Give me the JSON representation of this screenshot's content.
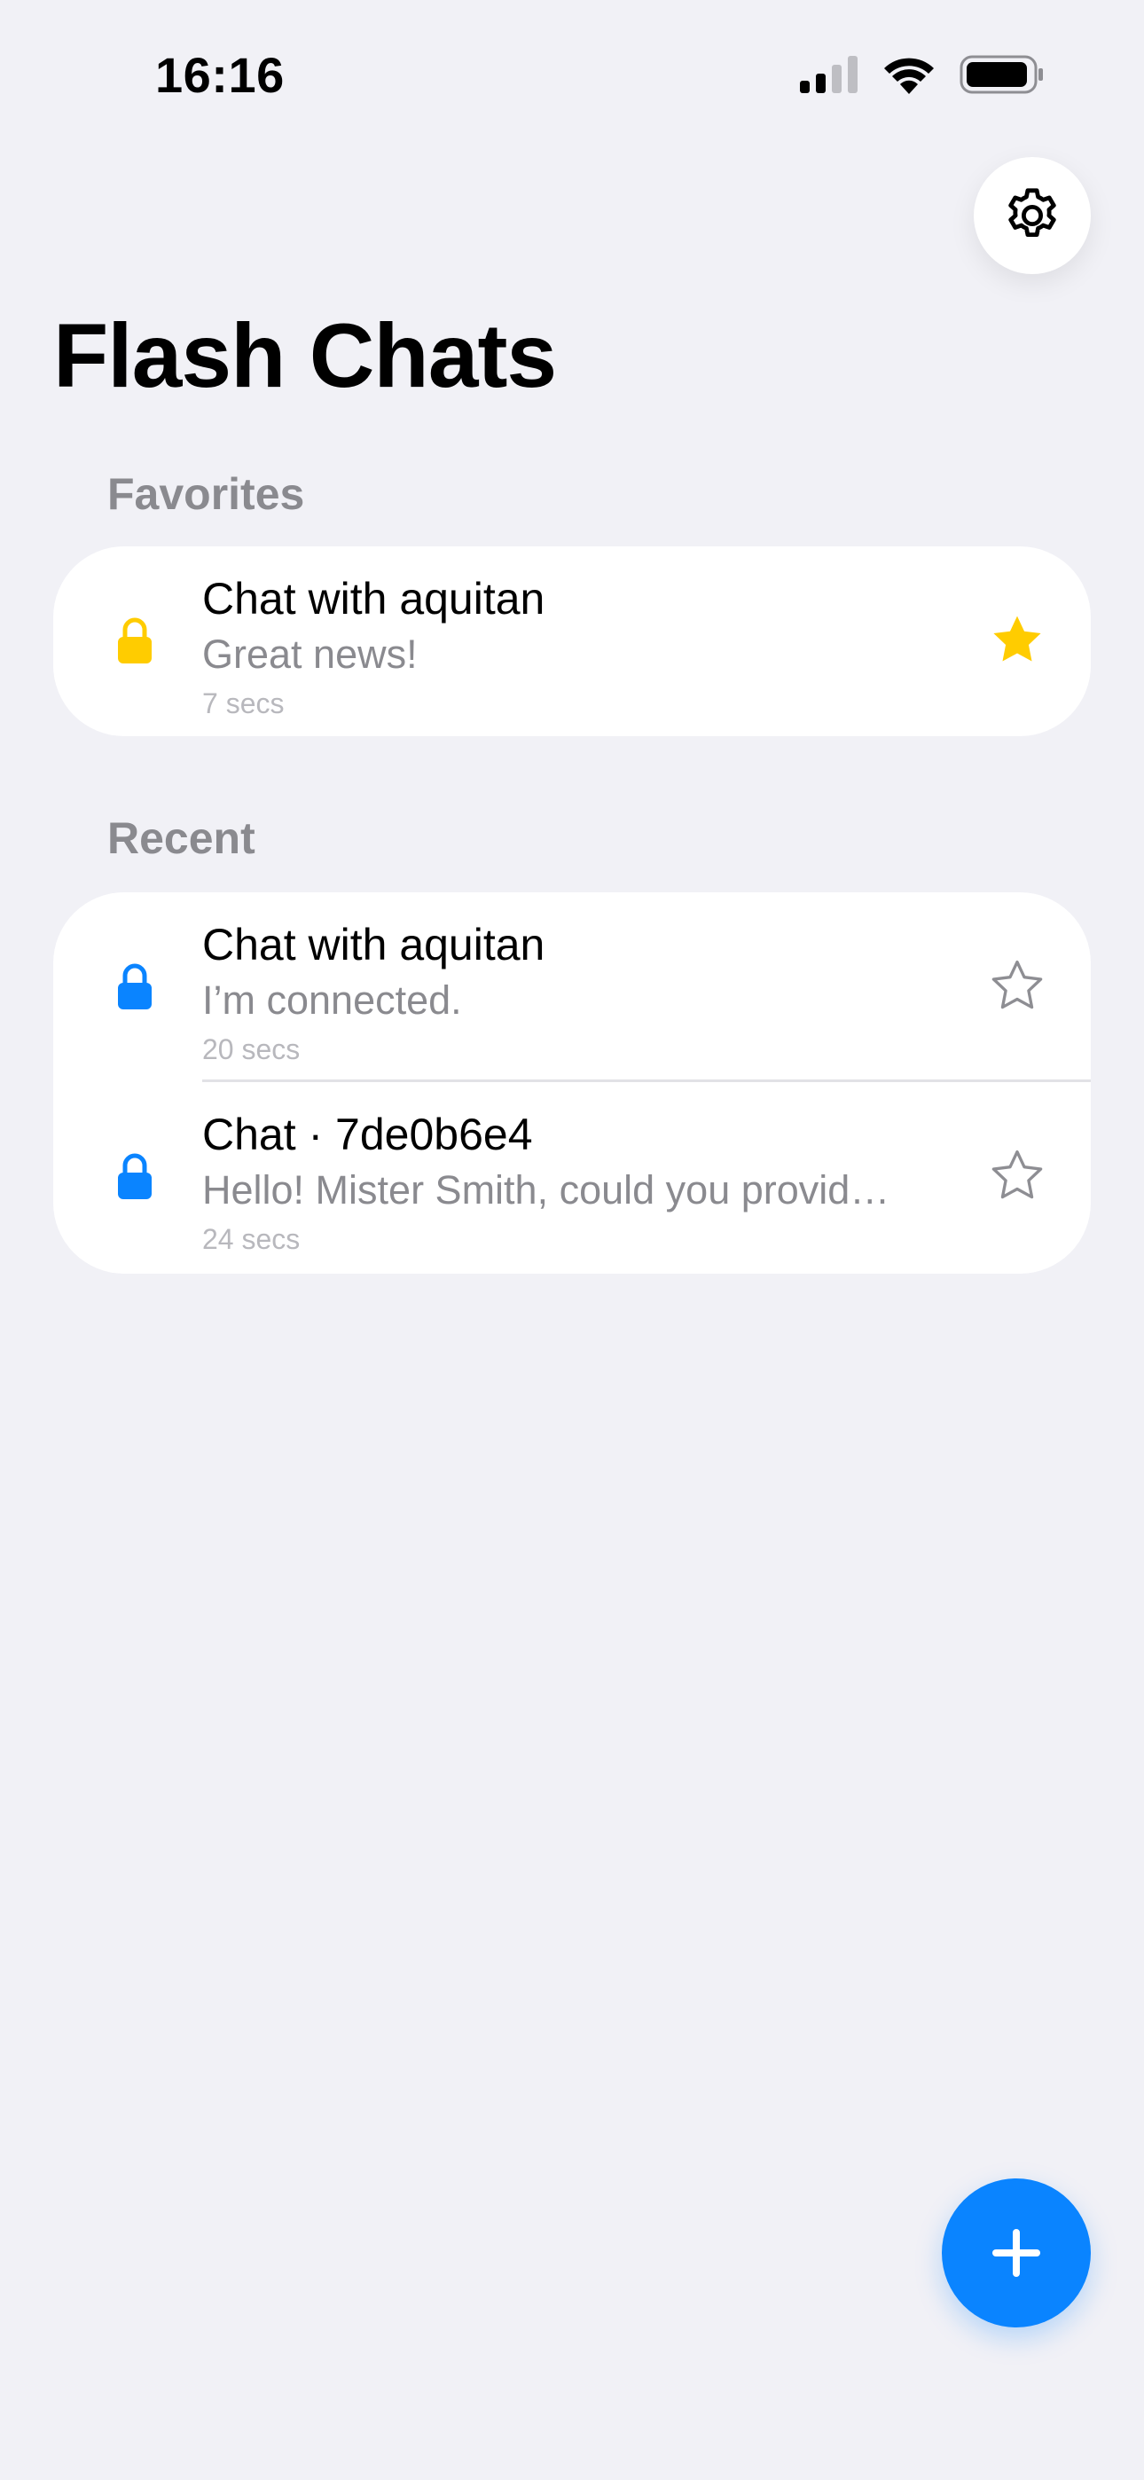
{
  "status_bar": {
    "time": "16:16"
  },
  "header": {
    "title": "Flash Chats"
  },
  "favorites": {
    "label": "Favorites",
    "items": [
      {
        "title": "Chat with aquitan",
        "preview": "Great news!",
        "time": "7 secs",
        "lock_color": "#FFCC00",
        "starred": true
      }
    ]
  },
  "recent": {
    "label": "Recent",
    "items": [
      {
        "title": "Chat with aquitan",
        "preview": "I’m connected.",
        "time": "20 secs",
        "lock_color": "#0A84FF",
        "starred": false
      },
      {
        "title": "Chat · 7de0b6e4",
        "preview": "Hello! Mister Smith, could you provid…",
        "time": "24 secs",
        "lock_color": "#0A84FF",
        "starred": false
      }
    ]
  },
  "colors": {
    "accent": "#0A84FF",
    "star_active": "#FFCC00",
    "background": "#F1F1F6"
  },
  "icons": {
    "settings": "gear-icon",
    "new_chat": "plus-icon",
    "lock": "lock-icon",
    "star": "star-icon"
  }
}
